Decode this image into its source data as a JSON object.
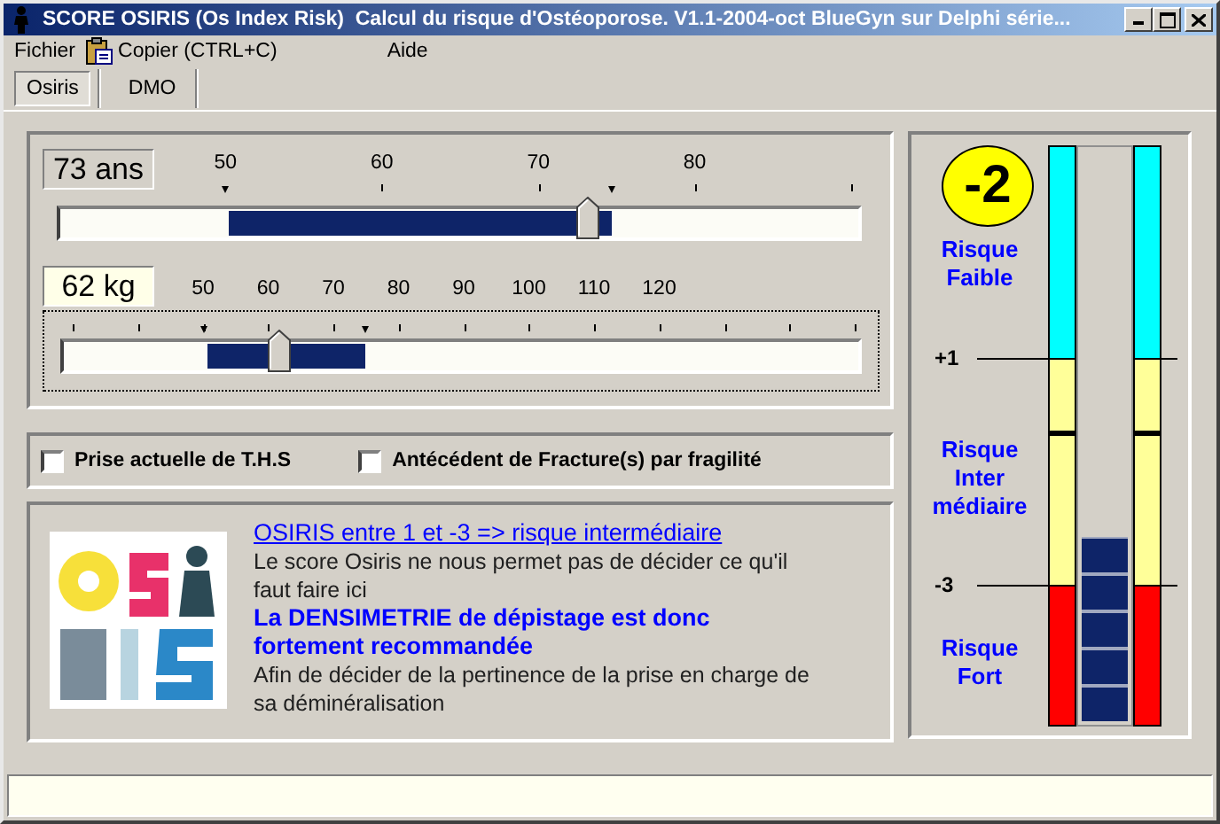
{
  "window": {
    "title": "SCORE OSIRIS (Os Index Risk)  Calcul du risque d'Ostéoporose. V1.1-2004-oct BlueGyn sur Delphi série..."
  },
  "menu": [
    {
      "label": "Fichier",
      "kind": "plain"
    },
    {
      "label": "Copier (CTRL+C)",
      "kind": "with_icon"
    },
    {
      "label": "Aide",
      "kind": "plain"
    }
  ],
  "tabs": [
    {
      "label": "Osiris",
      "selected": true
    },
    {
      "label": "DMO",
      "selected": false
    }
  ],
  "sliders": [
    {
      "value": "73 ans",
      "focused": false,
      "scale": [
        "50",
        "60",
        "70",
        "80"
      ],
      "thumb": {
        "level": 0.66
      },
      "range_start": {
        "level": 0.21
      },
      "range_end": {
        "level": 0.69
      }
    },
    {
      "value": "62 kg",
      "focused": true,
      "scale": [
        "50",
        "60",
        "70",
        "80",
        "90",
        "100",
        "110",
        "120"
      ],
      "thumb": {
        "level": 0.27
      },
      "range_start": {
        "level": 0.18
      },
      "range_end": {
        "level": 0.38
      }
    }
  ],
  "options": [
    {
      "label": "Prise actuelle de T.H.S",
      "checked": false
    },
    {
      "label": "Antécédent de Fracture(s) par fragilité",
      "checked": false
    }
  ],
  "result": {
    "messages": [
      {
        "kind": "heading",
        "text": "OSIRIS entre 1 et -3 => risque intermédiaire "
      },
      {
        "kind": "body",
        "text": "Le score Osiris ne nous permet pas de décider ce qu'il faut faire ici"
      },
      {
        "kind": "advice",
        "text": "La DENSIMETRIE de dépistage est donc fortement recommandée"
      },
      {
        "kind": "body",
        "text": "Afin de décider de la pertinence de la prise en charge de sa déminéralisation"
      }
    ]
  },
  "score": {
    "value": "-2",
    "gauge": {
      "level": 0.32
    },
    "zones": [
      {
        "label": "Risque Faible",
        "color": "#00ffff"
      },
      {
        "label": "Risque Inter médiaire",
        "threshold": "+1",
        "color": "#ffff99"
      },
      {
        "label": "Risque Fort",
        "threshold": "-3",
        "color": "#ff0000"
      }
    ]
  }
}
